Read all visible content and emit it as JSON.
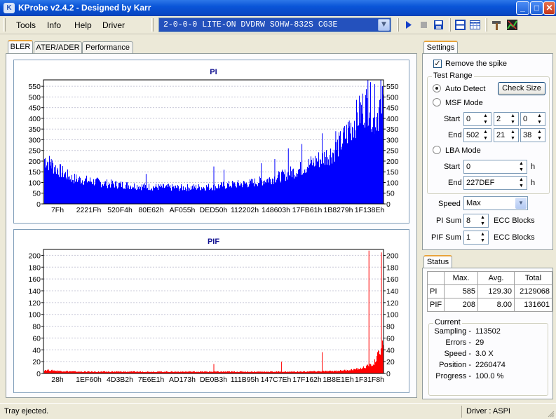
{
  "app": {
    "title": "KProbe v2.4.2 - Designed by Karr",
    "icon": "kprobe-app-icon"
  },
  "window_buttons": [
    "_",
    "□",
    "✕"
  ],
  "menu": {
    "tools": "Tools",
    "info": "Info",
    "help": "Help",
    "driver": "Driver"
  },
  "device": {
    "selected": "2-0-0-0 LITE-ON DVDRW SOHW-832S  CG3E"
  },
  "toolbar_icons": [
    "play-icon",
    "stop-icon",
    "save-icon",
    "layout-icon",
    "table-icon",
    "tools-icon",
    "chart-export-icon"
  ],
  "tabs": [
    {
      "label": "BLER",
      "active": true
    },
    {
      "label": "ATER/ADER",
      "active": false
    },
    {
      "label": "Performance",
      "active": false
    }
  ],
  "settings": {
    "tab": "Settings",
    "remove_spike": {
      "label": "Remove the spike",
      "checked": true
    },
    "test_range": {
      "label": "Test Range"
    },
    "auto_detect": {
      "label": "Auto Detect",
      "selected": true
    },
    "check_size": "Check Size",
    "msf_mode": {
      "label": "MSF Mode",
      "selected": false
    },
    "msf_start_label": "Start",
    "msf_start": [
      "0",
      "2",
      "0"
    ],
    "msf_end_label": "End",
    "msf_end": [
      "502",
      "21",
      "38"
    ],
    "lba_mode": {
      "label": "LBA Mode",
      "selected": false
    },
    "lba_start_label": "Start",
    "lba_start": "0",
    "lba_end_label": "End",
    "lba_end": "227DEF",
    "unit_h": "h",
    "speed_label": "Speed",
    "speed_value": "Max",
    "pi_sum_label": "PI Sum",
    "pi_sum_value": "8",
    "pif_sum_label": "PIF Sum",
    "pif_sum_value": "1",
    "ecc_blocks": "ECC Blocks"
  },
  "status": {
    "tab": "Status",
    "headers": [
      "Max.",
      "Avg.",
      "Total"
    ],
    "rows": [
      {
        "name": "PI",
        "max": "585",
        "avg": "129.30",
        "total": "2129068"
      },
      {
        "name": "PIF",
        "max": "208",
        "avg": "8.00",
        "total": "131601"
      }
    ],
    "current": {
      "label": "Current",
      "sampling_label": "Sampling -",
      "sampling": "113502",
      "errors_label": "Errors -",
      "errors": "29",
      "speed_label": "Speed -",
      "speed": "3.0  X",
      "position_label": "Position -",
      "position": "2260474",
      "progress_label": "Progress -",
      "progress": "100.0 %"
    }
  },
  "statusbar": {
    "message": "Tray ejected.",
    "driver": "Driver : ASPI"
  },
  "chart_data": [
    {
      "type": "bar",
      "title": "PI",
      "color": "#0000ff",
      "yticks": [
        0,
        50,
        100,
        150,
        200,
        250,
        300,
        350,
        400,
        450,
        500,
        550
      ],
      "ylim": [
        0,
        580
      ],
      "x_ticklabels": [
        "7Fh",
        "2221Fh",
        "520F4h",
        "80E62h",
        "AF055h",
        "DED50h",
        "112202h",
        "148603h",
        "17FB61h",
        "1B8279h",
        "1F138Eh"
      ],
      "profile_x": [
        0,
        0.03,
        0.08,
        0.18,
        0.3,
        0.4,
        0.5,
        0.55,
        0.6,
        0.65,
        0.7,
        0.75,
        0.8,
        0.85,
        0.88,
        0.9,
        0.92,
        0.94,
        0.96,
        0.97,
        0.98,
        1.0
      ],
      "profile_y": [
        210,
        170,
        120,
        95,
        80,
        75,
        80,
        90,
        95,
        110,
        130,
        160,
        200,
        240,
        300,
        350,
        400,
        450,
        470,
        380,
        420,
        480
      ],
      "spikes": [
        {
          "x": 0.02,
          "y": 210
        },
        {
          "x": 0.3,
          "y": 140
        },
        {
          "x": 0.5,
          "y": 175
        },
        {
          "x": 0.53,
          "y": 160
        },
        {
          "x": 0.64,
          "y": 190
        },
        {
          "x": 0.68,
          "y": 210
        },
        {
          "x": 0.72,
          "y": 260
        },
        {
          "x": 0.76,
          "y": 280
        },
        {
          "x": 0.82,
          "y": 330
        },
        {
          "x": 0.86,
          "y": 340
        },
        {
          "x": 0.9,
          "y": 390
        },
        {
          "x": 0.93,
          "y": 470
        },
        {
          "x": 0.955,
          "y": 580
        },
        {
          "x": 0.975,
          "y": 560
        },
        {
          "x": 0.993,
          "y": 580
        }
      ]
    },
    {
      "type": "bar",
      "title": "PIF",
      "color": "#ff0000",
      "yticks": [
        0,
        20,
        40,
        60,
        80,
        100,
        120,
        140,
        160,
        180,
        200
      ],
      "ylim": [
        0,
        210
      ],
      "x_ticklabels": [
        "28h",
        "1EF60h",
        "4D3B2h",
        "7E6E1h",
        "AD173h",
        "DE0B3h",
        "111B95h",
        "147C7Eh",
        "17F162h",
        "1B8E1Eh",
        "1F31F8h"
      ],
      "profile_x": [
        0,
        0.05,
        0.1,
        0.5,
        0.75,
        0.85,
        0.9,
        0.93,
        0.95,
        0.97,
        0.99,
        1.0
      ],
      "profile_y": [
        6,
        4,
        3,
        3,
        3,
        4,
        6,
        8,
        12,
        16,
        40,
        55
      ],
      "spikes": [
        {
          "x": 0.5,
          "y": 16
        },
        {
          "x": 0.7,
          "y": 20
        },
        {
          "x": 0.82,
          "y": 36
        },
        {
          "x": 0.958,
          "y": 208
        },
        {
          "x": 0.995,
          "y": 205
        }
      ]
    }
  ]
}
